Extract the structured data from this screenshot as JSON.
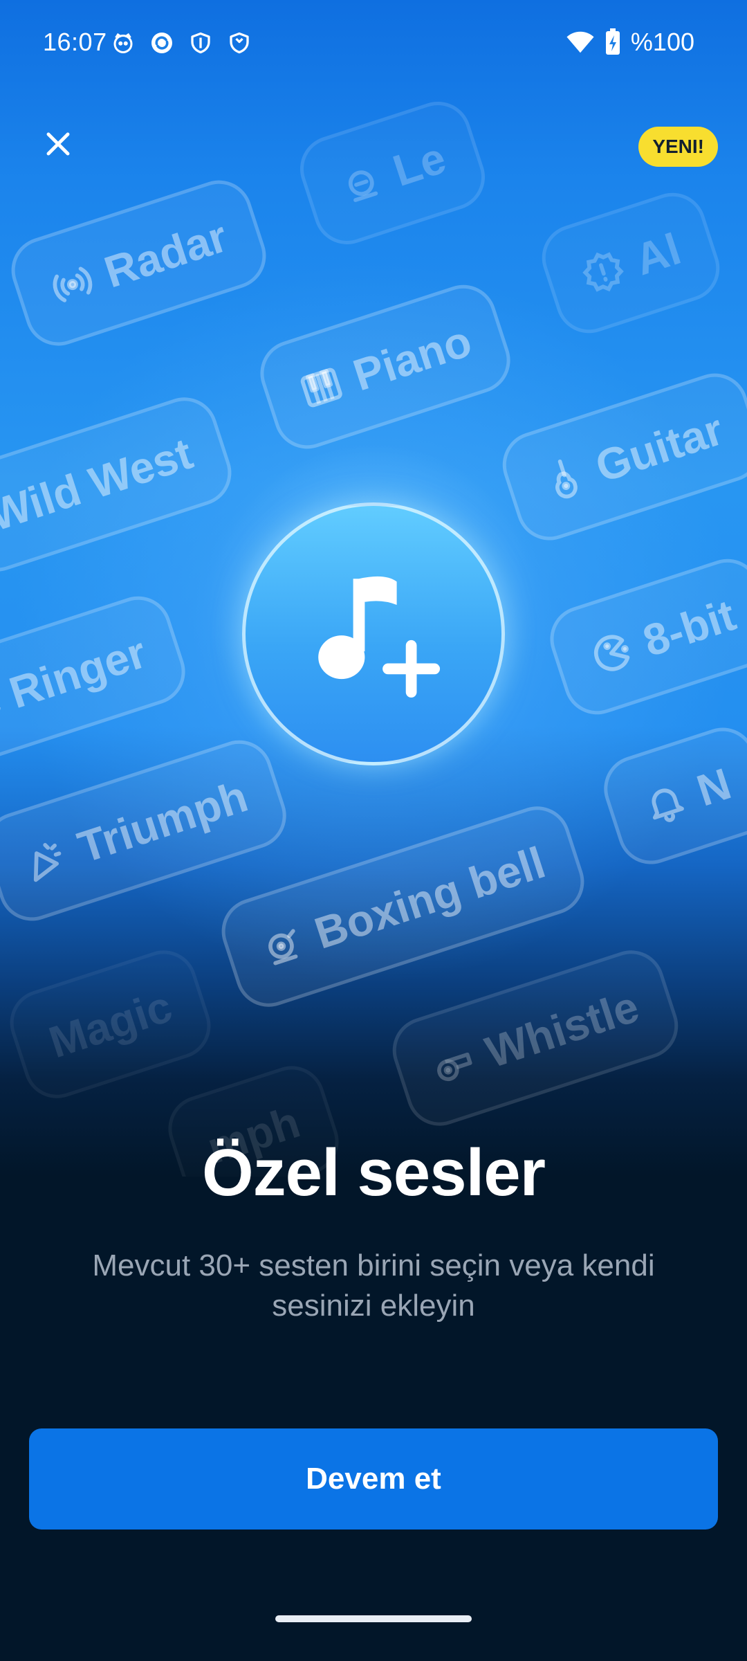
{
  "status_bar": {
    "time": "16:07",
    "battery": "%100",
    "left_icons": [
      "cat-face-icon",
      "app-sync-icon",
      "shield-icon",
      "shield-outline-icon"
    ],
    "right_icons": [
      "wifi-icon",
      "battery-charging-icon"
    ]
  },
  "header": {
    "close_icon": "close-icon",
    "badge_label": "YENI!"
  },
  "background_chips": [
    {
      "label": "Radar",
      "icon": "radar-icon"
    },
    {
      "label": "Le",
      "icon": "bell-ring-icon"
    },
    {
      "label": "Piano",
      "icon": "piano-icon"
    },
    {
      "label": "Al",
      "icon": "alert-badge-icon"
    },
    {
      "label": "Wild West",
      "icon": ""
    },
    {
      "label": "Guitar",
      "icon": "guitar-icon"
    },
    {
      "label": "e Ringer",
      "icon": ""
    },
    {
      "label": "8-bit",
      "icon": "pacman-icon"
    },
    {
      "label": "Triumph",
      "icon": "party-popper-icon"
    },
    {
      "label": "N",
      "icon": "bell-icon"
    },
    {
      "label": "Boxing bell",
      "icon": "bell-ring-icon"
    },
    {
      "label": "Magic",
      "icon": ""
    },
    {
      "label": "Whistle",
      "icon": "whistle-icon"
    },
    {
      "label": "mph",
      "icon": ""
    }
  ],
  "hero": {
    "icon": "music-note-plus-icon"
  },
  "content": {
    "title": "Özel sesler",
    "subtitle": "Mevcut 30+ sesten birini seçin veya kendi sesinizi ekleyin"
  },
  "cta": {
    "label": "Devem et"
  }
}
